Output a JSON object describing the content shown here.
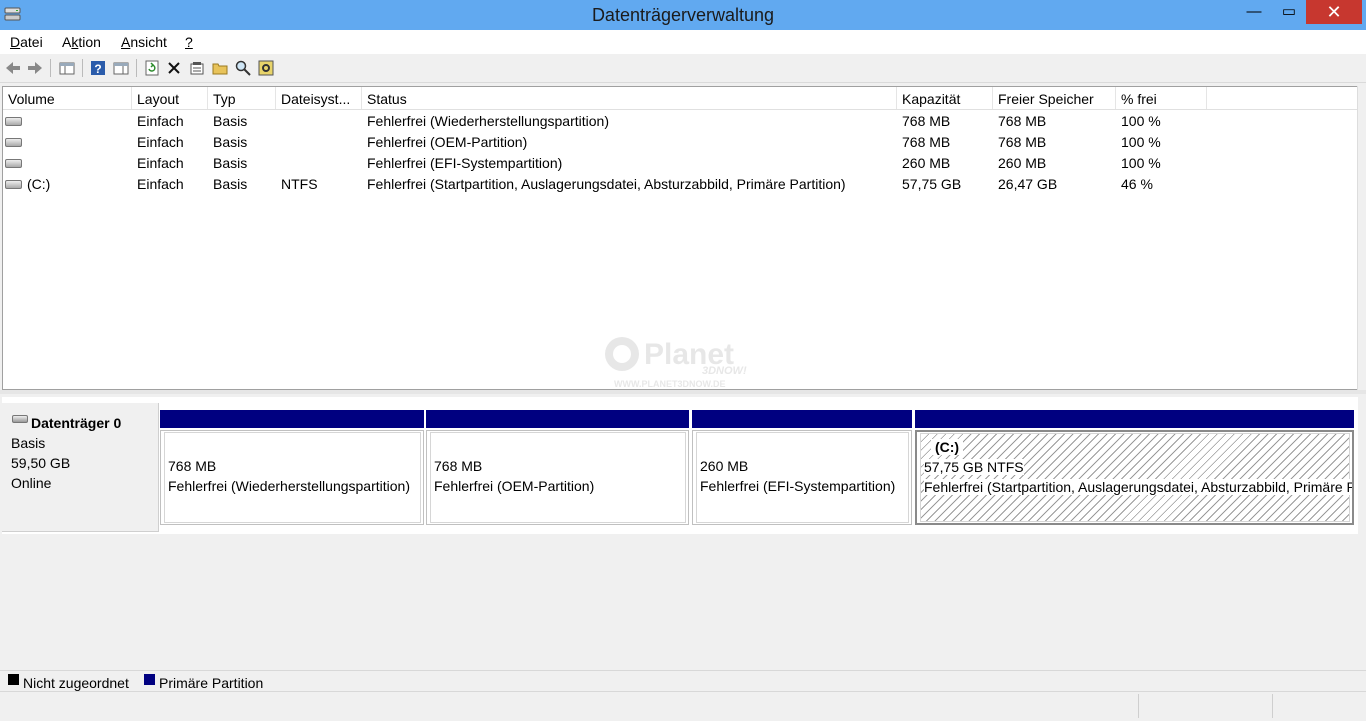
{
  "window": {
    "title": "Datenträgerverwaltung",
    "minimize": "—",
    "maximize": "▭",
    "close": "✕"
  },
  "menu": [
    {
      "pre": "",
      "ul": "D",
      "post": "atei"
    },
    {
      "pre": "A",
      "ul": "k",
      "post": "tion"
    },
    {
      "pre": "",
      "ul": "A",
      "post": "nsicht"
    },
    {
      "pre": "",
      "ul": "?",
      "post": ""
    }
  ],
  "toolbar": {
    "icons": [
      "back-icon",
      "forward-icon",
      "console-tree-icon",
      "help-icon",
      "properties-pane-icon",
      "refresh-icon",
      "delete-icon",
      "properties-icon",
      "open-icon",
      "search-icon",
      "settings-icon"
    ]
  },
  "table": {
    "columns": [
      "Volume",
      "Layout",
      "Typ",
      "Dateisyst...",
      "Status",
      "Kapazität",
      "Freier Speicher",
      "% frei"
    ],
    "rows": [
      {
        "volume": "",
        "layout": "Einfach",
        "typ": "Basis",
        "fs": "",
        "status": "Fehlerfrei (Wiederherstellungspartition)",
        "cap": "768 MB",
        "free": "768 MB",
        "pct": "100 %"
      },
      {
        "volume": "",
        "layout": "Einfach",
        "typ": "Basis",
        "fs": "",
        "status": "Fehlerfrei (OEM-Partition)",
        "cap": "768 MB",
        "free": "768 MB",
        "pct": "100 %"
      },
      {
        "volume": "",
        "layout": "Einfach",
        "typ": "Basis",
        "fs": "",
        "status": "Fehlerfrei (EFI-Systempartition)",
        "cap": "260 MB",
        "free": "260 MB",
        "pct": "100 %"
      },
      {
        "volume": "(C:)",
        "layout": "Einfach",
        "typ": "Basis",
        "fs": "NTFS",
        "status": "Fehlerfrei (Startpartition, Auslagerungsdatei, Absturzabbild, Primäre Partition)",
        "cap": "57,75 GB",
        "free": "26,47 GB",
        "pct": "46 %"
      }
    ]
  },
  "disk": {
    "name": "Datenträger 0",
    "type": "Basis",
    "size": "59,50 GB",
    "state": "Online",
    "partitions": [
      {
        "label": "",
        "size": "768 MB",
        "status": "Fehlerfrei (Wiederherstellungspartition)"
      },
      {
        "label": "",
        "size": "768 MB",
        "status": "Fehlerfrei (OEM-Partition)"
      },
      {
        "label": "",
        "size": "260 MB",
        "status": "Fehlerfrei (EFI-Systempartition)"
      },
      {
        "label": "(C:)",
        "size": "57,75 GB NTFS",
        "status": "Fehlerfrei (Startpartition, Auslagerungsdatei, Absturzabbild, Primäre Partition)"
      }
    ]
  },
  "legend": [
    {
      "label": "Nicht zugeordnet",
      "color": "#000000"
    },
    {
      "label": "Primäre Partition",
      "color": "#000080"
    }
  ],
  "watermark": {
    "text": "Planet",
    "sub": "3DNOW!",
    "url": "WWW.PLANET3DNOW.DE"
  },
  "colors": {
    "titlebar": "#61a9f0",
    "close": "#c7372f",
    "primary": "#000080"
  }
}
